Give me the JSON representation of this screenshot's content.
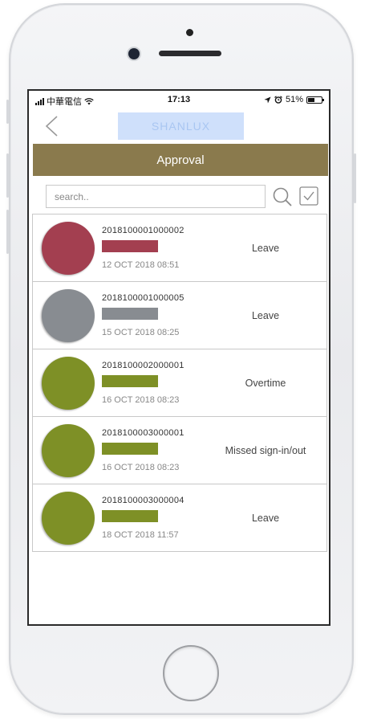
{
  "status_bar": {
    "carrier": "中華電信",
    "time": "17:13",
    "battery": "51%",
    "battery_level": 0.51
  },
  "header": {
    "logo_text": "SHANLUX",
    "title": "Approval"
  },
  "search": {
    "placeholder": "search.."
  },
  "requests": [
    {
      "number": "2018100001000002",
      "date": "12 OCT 2018 08:51",
      "type": "Leave",
      "avatar_color": "#a33f50",
      "name_bar_color": "#a33f50"
    },
    {
      "number": "2018100001000005",
      "date": "15 OCT 2018 08:25",
      "type": "Leave",
      "avatar_color": "#888c91",
      "name_bar_color": "#888c91"
    },
    {
      "number": "2018100002000001",
      "date": "16 OCT 2018 08:23",
      "type": "Overtime",
      "avatar_color": "#7e9026",
      "name_bar_color": "#7e9026"
    },
    {
      "number": "2018100003000001",
      "date": "16 OCT 2018 08:23",
      "type": "Missed sign-in/out",
      "avatar_color": "#7e9026",
      "name_bar_color": "#7e9026"
    },
    {
      "number": "2018100003000004",
      "date": "18 OCT 2018 11:57",
      "type": "Leave",
      "avatar_color": "#7e9026",
      "name_bar_color": "#7e9026"
    }
  ],
  "colors": {
    "title_bar": "#8a7a4d",
    "logo_placeholder": "#cfe0fb",
    "divider": "#c8c8c8"
  }
}
